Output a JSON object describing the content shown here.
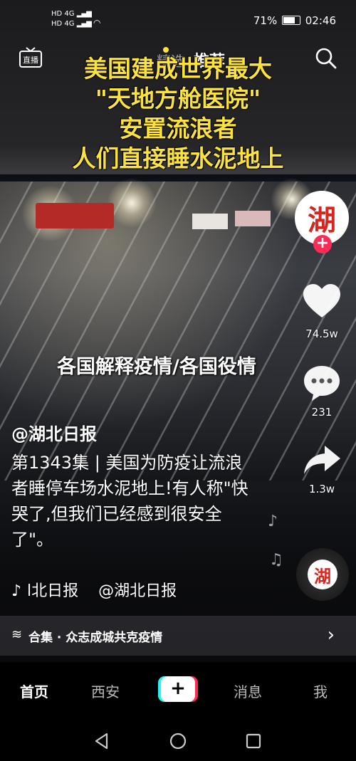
{
  "status_bar": {
    "network_left_top": "HD 4G",
    "network_left_bottom": "HD 4G",
    "battery": "71%",
    "time": "02:46"
  },
  "top_bar": {
    "live_label": "直播",
    "tab_featured": "精选",
    "tab_recommend": "推荐"
  },
  "caption": {
    "line1": "美国建成世界最大",
    "line2": "\"天地方舱医院\"",
    "line3": "安置流浪者",
    "line4": "人们直接睡水泥地上"
  },
  "overlay": {
    "title": "各国解释疫情/各国役情"
  },
  "post": {
    "author": "@湖北日报",
    "description": "第1343集 | 美国为防疫让流浪者睡停车场水泥地上!有人称\"快哭了,但我们已经感到很安全了\"。",
    "music": "l北日报    @湖北日报"
  },
  "right_rail": {
    "avatar_char": "湖",
    "likes": "74.5w",
    "comments": "231",
    "shares": "1.3w",
    "disc_char": "湖"
  },
  "collection": {
    "label": "合集 · 众志成城共克疫情"
  },
  "bottom_nav": {
    "home": "首页",
    "city": "西安",
    "plus": "+",
    "messages": "消息",
    "me": "我"
  },
  "colors": {
    "caption_yellow": "#fbe23c",
    "accent_red": "#fe2c55",
    "tiktok_cyan": "#25f4ee"
  }
}
